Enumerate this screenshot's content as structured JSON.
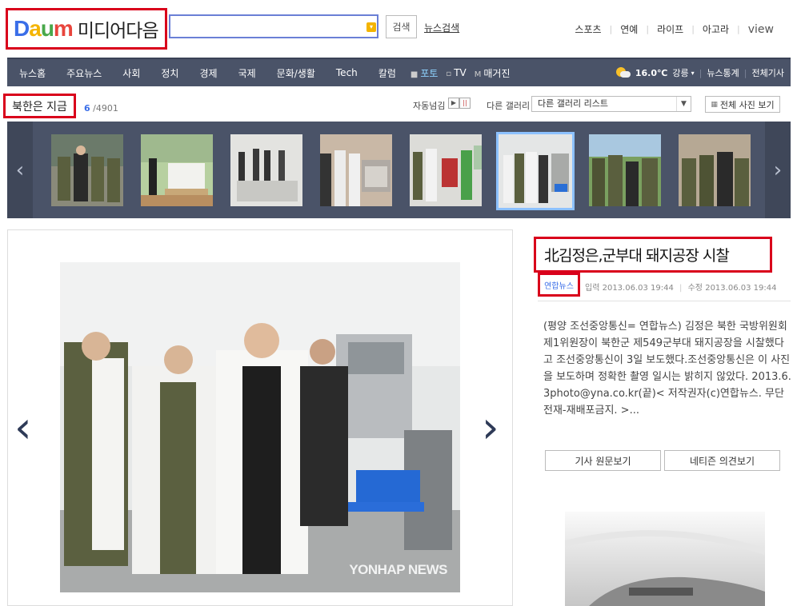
{
  "header": {
    "logo_letters": [
      "D",
      "a",
      "u",
      "m"
    ],
    "logo_text": "미디어다음",
    "search_value": "",
    "search_button": "검색",
    "news_search": "뉴스검색",
    "top_links": [
      "스포츠",
      "연예",
      "라이프",
      "아고라"
    ],
    "view_link": "view"
  },
  "nav": {
    "items": [
      "뉴스홈",
      "주요뉴스",
      "사회",
      "정치",
      "경제",
      "국제",
      "문화/생활",
      "Tech",
      "칼럼"
    ],
    "media_items": [
      {
        "icon": "■",
        "label": "포토",
        "active": true
      },
      {
        "icon": "▫",
        "label": "TV",
        "active": false
      },
      {
        "icon": "M",
        "label": "매거진",
        "active": false
      }
    ],
    "weather": {
      "temp": "16.0℃",
      "location": "강릉"
    },
    "right_links": [
      "뉴스통계",
      "전체기사"
    ]
  },
  "gallery": {
    "title": "북한은 지금",
    "current": "6",
    "total": "/4901",
    "auto_label": "자동넘김",
    "play_icon": "▶",
    "pause_icon": "||",
    "other_label": "다른 갤러리",
    "other_select": "다른 갤러리 리스트",
    "all_photos": "전체 사진 보기",
    "thumbnails": [
      {
        "name": "thumb-1",
        "selected": false
      },
      {
        "name": "thumb-2",
        "selected": false
      },
      {
        "name": "thumb-3",
        "selected": false
      },
      {
        "name": "thumb-4",
        "selected": false
      },
      {
        "name": "thumb-5",
        "selected": false
      },
      {
        "name": "thumb-6",
        "selected": true
      },
      {
        "name": "thumb-7",
        "selected": false
      },
      {
        "name": "thumb-8",
        "selected": false
      }
    ]
  },
  "photo": {
    "watermark": "YONHAP NEWS"
  },
  "article": {
    "title": "北김정은,군부대 돼지공장 시찰",
    "source": "연합뉴스",
    "input_label": "입력",
    "input_time": "2013.06.03 19:44",
    "edit_label": "수정",
    "edit_time": "2013.06.03 19:44",
    "body": "(평양 조선중앙통신= 연합뉴스) 김정은 북한 국방위원회 제1위원장이 북한군 제549군부대 돼지공장을 시찰했다고 조선중앙통신이 3일 보도했다.조선중앙통신은 이 사진을 보도하며 정확한 촬영 일시는 밝히지 않았다. 2013.6.3photo@yna.co.kr(끝)< 저작권자(c)연합뉴스. 무단전재-재배포금지. >...",
    "btn_original": "기사 원문보기",
    "btn_comments": "네티즌 의견보기"
  },
  "colors": {
    "nav_bg": "#4a5368",
    "highlight_red": "#d9001b",
    "link_blue": "#3a6ee8"
  }
}
